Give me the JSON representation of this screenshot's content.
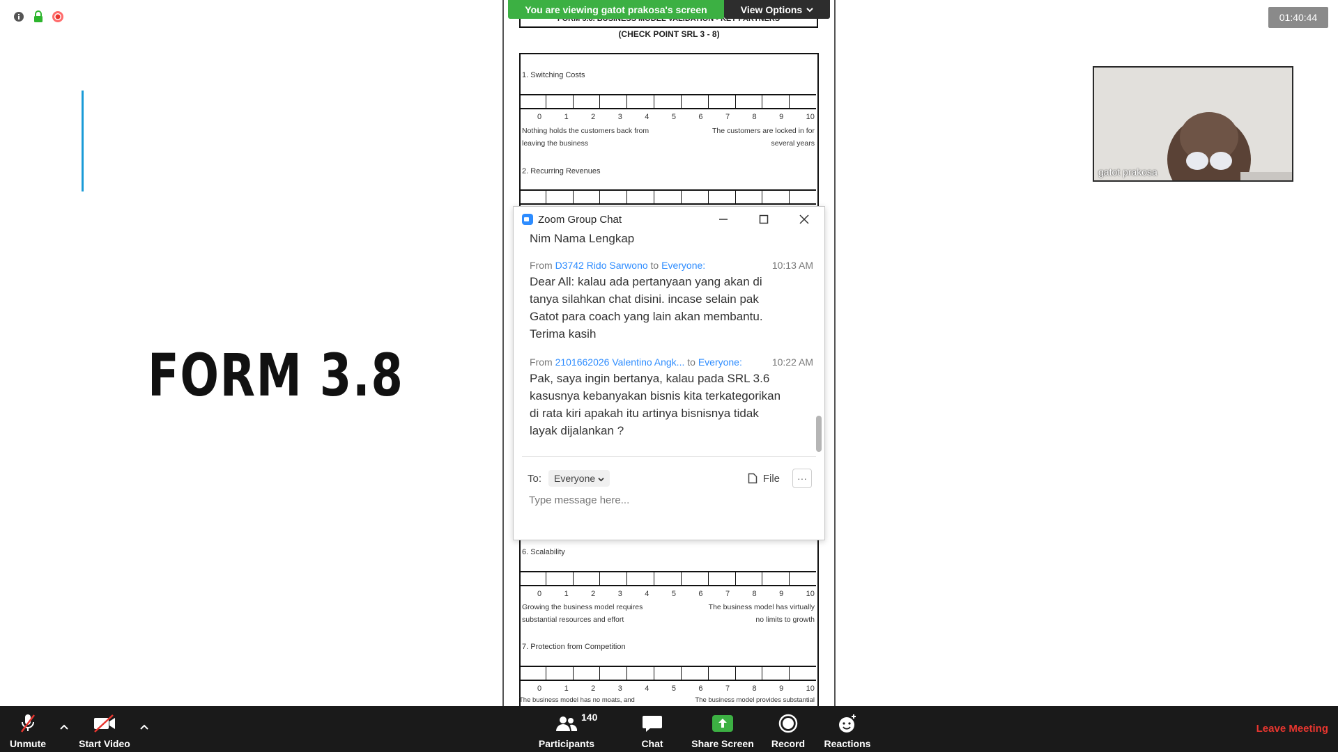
{
  "timer": "01:40:44",
  "slide": {
    "title": "FORM 3.8"
  },
  "share": {
    "banner": "You are viewing gatot prakosa's screen",
    "view_options": "View Options"
  },
  "document": {
    "title": "FORM 3.8. BUSINESS MODEL VALIDATION - KEY PARTNERS",
    "subtitle": "(CHECK POINT SRL 3 - 8)",
    "scale_numbers": [
      "0",
      "1",
      "2",
      "3",
      "4",
      "5",
      "6",
      "7",
      "8",
      "9",
      "10"
    ],
    "sections": [
      {
        "label": "1. Switching Costs",
        "left": "Nothing holds the customers back from leaving the business",
        "right": "The customers are locked in for several years"
      },
      {
        "label": "2. Recurring Revenues"
      },
      {
        "label": "6. Scalability",
        "left": "Growing the business model requires substantial resources and effort",
        "right": "The business model has virtually no limits to growth"
      },
      {
        "label": "7. Protection from Competition",
        "left": "The business model has no moats, and",
        "right": "The business model provides substantial"
      }
    ]
  },
  "chat": {
    "title": "Zoom Group Chat",
    "prev_line": "Nim Nama Lengkap",
    "messages": [
      {
        "from_label": "From",
        "sender": "D3742 Rido Sarwono",
        "to_label": "to",
        "recipient": "Everyone:",
        "time": "10:13 AM",
        "text": "Dear All: kalau ada pertanyaan yang akan di tanya silahkan chat disini. incase selain pak Gatot para coach yang lain akan membantu. Terima kasih"
      },
      {
        "from_label": "From",
        "sender": "2101662026 Valentino Angk...",
        "to_label": "to",
        "recipient": "Everyone:",
        "time": "10:22 AM",
        "text": "Pak, saya ingin bertanya, kalau pada SRL 3.6 kasusnya kebanyakan bisnis kita terkategorikan di rata kiri apakah itu artinya bisnisnya tidak layak dijalankan ?"
      }
    ],
    "to_label": "To:",
    "to_value": "Everyone",
    "file_label": "File",
    "input_placeholder": "Type message here..."
  },
  "video": {
    "name": "gatot prakosa"
  },
  "toolbar": {
    "unmute": "Unmute",
    "start_video": "Start Video",
    "participants": "Participants",
    "participants_count": "140",
    "chat": "Chat",
    "share_screen": "Share Screen",
    "record": "Record",
    "reactions": "Reactions",
    "leave": "Leave Meeting"
  },
  "colors": {
    "zoom_blue": "#2d8cff",
    "share_green": "#3cb043",
    "leave_red": "#e8362f",
    "toolbar_bg": "#1a1a1a"
  }
}
